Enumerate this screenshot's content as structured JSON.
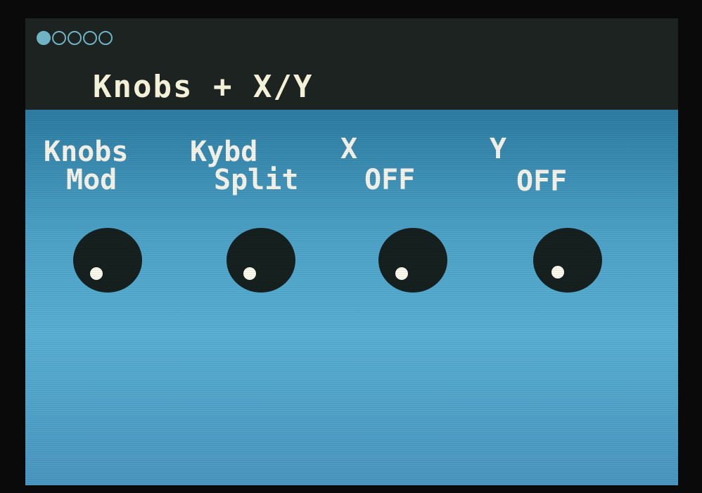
{
  "page_indicator": {
    "total": 5,
    "active_index": 0
  },
  "header": {
    "title": "Knobs + X/Y"
  },
  "params": [
    {
      "line1": "Knobs",
      "line2": "Mod"
    },
    {
      "line1": "Kybd",
      "line2": "Split"
    },
    {
      "line1": "X",
      "line2": "OFF"
    },
    {
      "line1": "Y",
      "line2": "OFF"
    }
  ],
  "colors": {
    "header_bg": "#1c2320",
    "panel_blue": "#4ea4c9",
    "text": "#f6f4ea",
    "knob": "#16201f",
    "dot": "#6fb3c4"
  }
}
